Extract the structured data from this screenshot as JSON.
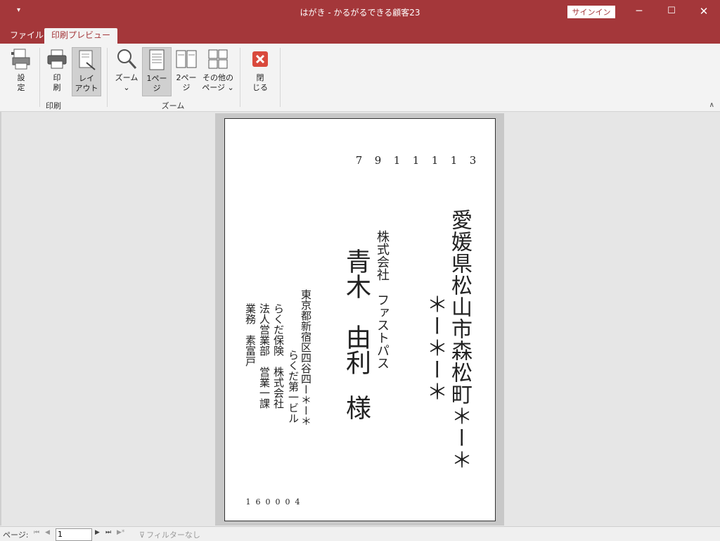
{
  "titlebar": {
    "qat": "▾",
    "title": "はがき  -  かるがるできる顧客23",
    "signin": "サインイン"
  },
  "tabs": {
    "file": "ファイル",
    "active": "印刷プレビュー"
  },
  "ribbon": {
    "settings": "設\n定",
    "print": "印\n刷",
    "layout": "レイ\nアウト",
    "zoom": "ズーム\n⌄",
    "one_page": "1ペー\nジ",
    "two_page": "2ペー\nジ",
    "other_pages": "その他の\nページ ⌄",
    "close": "閉\nじる",
    "group_print": "印刷",
    "group_zoom": "ズーム"
  },
  "postcard": {
    "dest_zip": [
      "7",
      "9",
      "1",
      "1",
      "1",
      "1",
      "3"
    ],
    "dest_addr_line1": "愛媛県松山市森松町＊ー＊",
    "dest_addr_line2": "＊ー＊ー＊",
    "dest_company": "株式会社　ファストパス",
    "dest_name": "青木　由利",
    "dest_honorific": "様",
    "src_addr1": "東京都新宿区四谷四ー＊ー＊",
    "src_addr2": "らくだ第一ビル",
    "src_company": "らくだ保険　株式会社",
    "src_dept": "法人営業部　営業一課",
    "src_name": "業務　素富戸",
    "src_zip": [
      "1",
      "6",
      "0",
      "0",
      "0",
      "4"
    ]
  },
  "statusbar": {
    "page_label": "ページ:",
    "page_value": "1",
    "filter": "フィルターなし"
  }
}
